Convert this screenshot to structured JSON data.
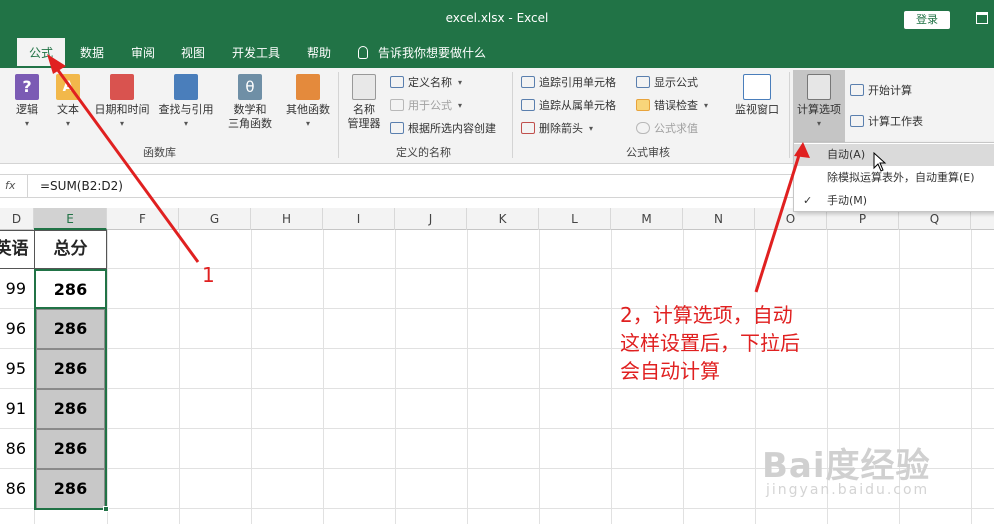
{
  "window": {
    "title": "excel.xlsx  -  Excel",
    "login_label": "登录"
  },
  "tabs": [
    {
      "label": "公式",
      "active": true
    },
    {
      "label": "数据"
    },
    {
      "label": "审阅"
    },
    {
      "label": "视图"
    },
    {
      "label": "开发工具"
    },
    {
      "label": "帮助"
    }
  ],
  "tell_me": "告诉我你想要做什么",
  "ribbon": {
    "function_library": {
      "label": "函数库",
      "buttons": [
        {
          "label": "逻辑"
        },
        {
          "label": "文本"
        },
        {
          "label": "日期和时间"
        },
        {
          "label": "查找与引用"
        },
        {
          "label": "数学和\n三角函数"
        },
        {
          "label": "其他函数"
        }
      ]
    },
    "defined_names": {
      "label": "定义的名称",
      "name_manager": "名称\n管理器",
      "define_name": "定义名称",
      "use_in_formula": "用于公式",
      "create_from_selection": "根据所选内容创建"
    },
    "formula_auditing": {
      "label": "公式审核",
      "trace_precedents": "追踪引用单元格",
      "trace_dependents": "追踪从属单元格",
      "remove_arrows": "删除箭头",
      "show_formulas": "显示公式",
      "error_checking": "错误检查",
      "evaluate_formula": "公式求值",
      "watch_window": "监视窗口"
    },
    "calculation": {
      "options_label": "计算选项",
      "calc_now": "开始计算",
      "calc_sheet": "计算工作表"
    }
  },
  "calc_menu": {
    "items": [
      {
        "label": "自动(A)",
        "hover": true,
        "checked": false
      },
      {
        "label": "除模拟运算表外，自动重算(E)",
        "checked": false
      },
      {
        "label": "手动(M)",
        "checked": true
      }
    ],
    "check_glyph": "✓"
  },
  "formula_bar": {
    "fx_label": "fx",
    "formula": "=SUM(B2:D2)"
  },
  "grid": {
    "columns": [
      "D",
      "E",
      "F",
      "G",
      "H",
      "I",
      "J",
      "K",
      "L",
      "M",
      "N",
      "O",
      "P",
      "Q"
    ],
    "header_d": "英语",
    "header_e": "总分",
    "d_values": [
      "99",
      "96",
      "95",
      "91",
      "86",
      "86"
    ],
    "e_values": [
      "286",
      "286",
      "286",
      "286",
      "286",
      "286"
    ]
  },
  "annotations": {
    "label_1": "1",
    "label_2_line1": "2，计算选项，自动",
    "label_2_line2": "这样设置后，下拉后",
    "label_2_line3": "会自动计算",
    "color": "#e02020"
  },
  "watermark": {
    "line1": "Bai度经验",
    "line2": "jingyan.baidu.com"
  },
  "colors": {
    "excel_green": "#217346",
    "ribbon_bg": "#f3f3f3"
  }
}
